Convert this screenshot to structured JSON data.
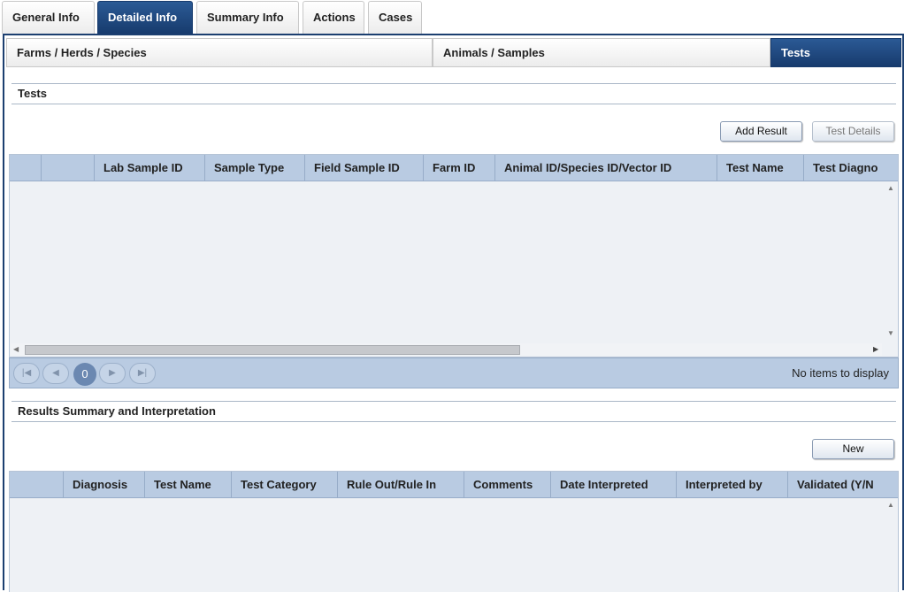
{
  "top_tabs": [
    {
      "label": "General Info",
      "active": false
    },
    {
      "label": "Detailed Info",
      "active": true
    },
    {
      "label": "Summary Info",
      "active": false
    },
    {
      "label": "Actions",
      "active": false
    },
    {
      "label": "Cases",
      "active": false
    }
  ],
  "sub_tabs": [
    {
      "label": "Farms / Herds / Species",
      "active": false
    },
    {
      "label": "Animals / Samples",
      "active": false
    },
    {
      "label": "Tests",
      "active": true
    }
  ],
  "tests_section": {
    "title": "Tests",
    "add_result_label": "Add Result",
    "test_details_label": "Test Details",
    "columns": [
      "",
      "",
      "Lab Sample ID",
      "Sample Type",
      "Field Sample ID",
      "Farm ID",
      "Animal ID/Species ID/Vector ID",
      "Test Name",
      "Test Diagno"
    ],
    "rows": []
  },
  "pager": {
    "first_icon": "first-page-icon",
    "prev_icon": "prev-page-icon",
    "page_number": "0",
    "next_icon": "next-page-icon",
    "last_icon": "last-page-icon",
    "status": "No items to display"
  },
  "results_section": {
    "title": "Results Summary and Interpretation",
    "new_label": "New",
    "columns": [
      "",
      "Diagnosis",
      "Test Name",
      "Test Category",
      "Rule Out/Rule In",
      "Comments",
      "Date Interpreted",
      "Interpreted by",
      "Validated (Y/N"
    ],
    "rows": []
  },
  "colors": {
    "active_tab": "#1f4a82",
    "grid_header": "#b9cbe2",
    "grid_body": "#eef1f5"
  }
}
